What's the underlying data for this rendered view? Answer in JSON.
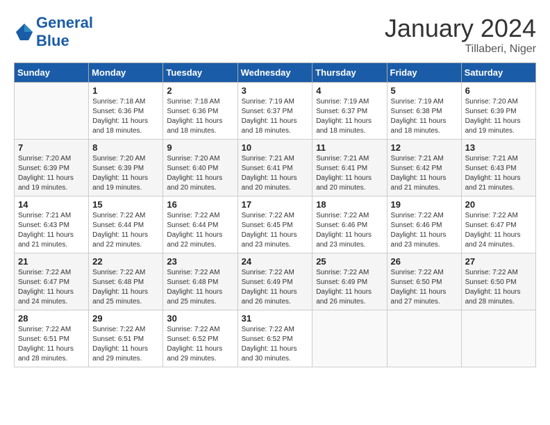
{
  "header": {
    "logo_text_general": "General",
    "logo_text_blue": "Blue",
    "month_title": "January 2024",
    "subtitle": "Tillaberi, Niger"
  },
  "days_of_week": [
    "Sunday",
    "Monday",
    "Tuesday",
    "Wednesday",
    "Thursday",
    "Friday",
    "Saturday"
  ],
  "weeks": [
    [
      {
        "num": "",
        "sunrise": "",
        "sunset": "",
        "daylight": ""
      },
      {
        "num": "1",
        "sunrise": "Sunrise: 7:18 AM",
        "sunset": "Sunset: 6:36 PM",
        "daylight": "Daylight: 11 hours and 18 minutes."
      },
      {
        "num": "2",
        "sunrise": "Sunrise: 7:18 AM",
        "sunset": "Sunset: 6:36 PM",
        "daylight": "Daylight: 11 hours and 18 minutes."
      },
      {
        "num": "3",
        "sunrise": "Sunrise: 7:19 AM",
        "sunset": "Sunset: 6:37 PM",
        "daylight": "Daylight: 11 hours and 18 minutes."
      },
      {
        "num": "4",
        "sunrise": "Sunrise: 7:19 AM",
        "sunset": "Sunset: 6:37 PM",
        "daylight": "Daylight: 11 hours and 18 minutes."
      },
      {
        "num": "5",
        "sunrise": "Sunrise: 7:19 AM",
        "sunset": "Sunset: 6:38 PM",
        "daylight": "Daylight: 11 hours and 18 minutes."
      },
      {
        "num": "6",
        "sunrise": "Sunrise: 7:20 AM",
        "sunset": "Sunset: 6:39 PM",
        "daylight": "Daylight: 11 hours and 19 minutes."
      }
    ],
    [
      {
        "num": "7",
        "sunrise": "Sunrise: 7:20 AM",
        "sunset": "Sunset: 6:39 PM",
        "daylight": "Daylight: 11 hours and 19 minutes."
      },
      {
        "num": "8",
        "sunrise": "Sunrise: 7:20 AM",
        "sunset": "Sunset: 6:39 PM",
        "daylight": "Daylight: 11 hours and 19 minutes."
      },
      {
        "num": "9",
        "sunrise": "Sunrise: 7:20 AM",
        "sunset": "Sunset: 6:40 PM",
        "daylight": "Daylight: 11 hours and 20 minutes."
      },
      {
        "num": "10",
        "sunrise": "Sunrise: 7:21 AM",
        "sunset": "Sunset: 6:41 PM",
        "daylight": "Daylight: 11 hours and 20 minutes."
      },
      {
        "num": "11",
        "sunrise": "Sunrise: 7:21 AM",
        "sunset": "Sunset: 6:41 PM",
        "daylight": "Daylight: 11 hours and 20 minutes."
      },
      {
        "num": "12",
        "sunrise": "Sunrise: 7:21 AM",
        "sunset": "Sunset: 6:42 PM",
        "daylight": "Daylight: 11 hours and 21 minutes."
      },
      {
        "num": "13",
        "sunrise": "Sunrise: 7:21 AM",
        "sunset": "Sunset: 6:43 PM",
        "daylight": "Daylight: 11 hours and 21 minutes."
      }
    ],
    [
      {
        "num": "14",
        "sunrise": "Sunrise: 7:21 AM",
        "sunset": "Sunset: 6:43 PM",
        "daylight": "Daylight: 11 hours and 21 minutes."
      },
      {
        "num": "15",
        "sunrise": "Sunrise: 7:22 AM",
        "sunset": "Sunset: 6:44 PM",
        "daylight": "Daylight: 11 hours and 22 minutes."
      },
      {
        "num": "16",
        "sunrise": "Sunrise: 7:22 AM",
        "sunset": "Sunset: 6:44 PM",
        "daylight": "Daylight: 11 hours and 22 minutes."
      },
      {
        "num": "17",
        "sunrise": "Sunrise: 7:22 AM",
        "sunset": "Sunset: 6:45 PM",
        "daylight": "Daylight: 11 hours and 23 minutes."
      },
      {
        "num": "18",
        "sunrise": "Sunrise: 7:22 AM",
        "sunset": "Sunset: 6:46 PM",
        "daylight": "Daylight: 11 hours and 23 minutes."
      },
      {
        "num": "19",
        "sunrise": "Sunrise: 7:22 AM",
        "sunset": "Sunset: 6:46 PM",
        "daylight": "Daylight: 11 hours and 23 minutes."
      },
      {
        "num": "20",
        "sunrise": "Sunrise: 7:22 AM",
        "sunset": "Sunset: 6:47 PM",
        "daylight": "Daylight: 11 hours and 24 minutes."
      }
    ],
    [
      {
        "num": "21",
        "sunrise": "Sunrise: 7:22 AM",
        "sunset": "Sunset: 6:47 PM",
        "daylight": "Daylight: 11 hours and 24 minutes."
      },
      {
        "num": "22",
        "sunrise": "Sunrise: 7:22 AM",
        "sunset": "Sunset: 6:48 PM",
        "daylight": "Daylight: 11 hours and 25 minutes."
      },
      {
        "num": "23",
        "sunrise": "Sunrise: 7:22 AM",
        "sunset": "Sunset: 6:48 PM",
        "daylight": "Daylight: 11 hours and 25 minutes."
      },
      {
        "num": "24",
        "sunrise": "Sunrise: 7:22 AM",
        "sunset": "Sunset: 6:49 PM",
        "daylight": "Daylight: 11 hours and 26 minutes."
      },
      {
        "num": "25",
        "sunrise": "Sunrise: 7:22 AM",
        "sunset": "Sunset: 6:49 PM",
        "daylight": "Daylight: 11 hours and 26 minutes."
      },
      {
        "num": "26",
        "sunrise": "Sunrise: 7:22 AM",
        "sunset": "Sunset: 6:50 PM",
        "daylight": "Daylight: 11 hours and 27 minutes."
      },
      {
        "num": "27",
        "sunrise": "Sunrise: 7:22 AM",
        "sunset": "Sunset: 6:50 PM",
        "daylight": "Daylight: 11 hours and 28 minutes."
      }
    ],
    [
      {
        "num": "28",
        "sunrise": "Sunrise: 7:22 AM",
        "sunset": "Sunset: 6:51 PM",
        "daylight": "Daylight: 11 hours and 28 minutes."
      },
      {
        "num": "29",
        "sunrise": "Sunrise: 7:22 AM",
        "sunset": "Sunset: 6:51 PM",
        "daylight": "Daylight: 11 hours and 29 minutes."
      },
      {
        "num": "30",
        "sunrise": "Sunrise: 7:22 AM",
        "sunset": "Sunset: 6:52 PM",
        "daylight": "Daylight: 11 hours and 29 minutes."
      },
      {
        "num": "31",
        "sunrise": "Sunrise: 7:22 AM",
        "sunset": "Sunset: 6:52 PM",
        "daylight": "Daylight: 11 hours and 30 minutes."
      },
      {
        "num": "",
        "sunrise": "",
        "sunset": "",
        "daylight": ""
      },
      {
        "num": "",
        "sunrise": "",
        "sunset": "",
        "daylight": ""
      },
      {
        "num": "",
        "sunrise": "",
        "sunset": "",
        "daylight": ""
      }
    ]
  ]
}
